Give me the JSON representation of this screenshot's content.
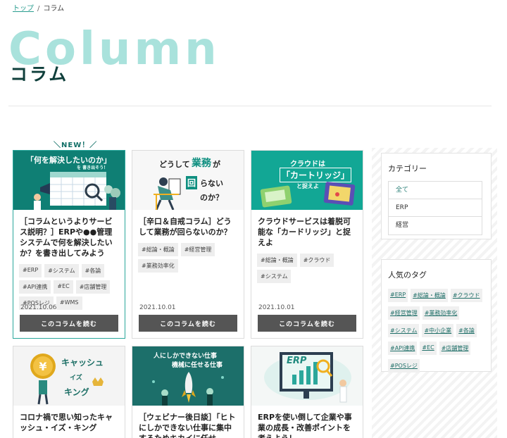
{
  "breadcrumb": {
    "home": "トップ",
    "separator": "/",
    "current": "コラム"
  },
  "hero": {
    "title_en": "Column",
    "title_ja": "コラム"
  },
  "new_label": "＼NEW！／",
  "read_button": "このコラムを読む",
  "cards": [
    {
      "thumb_lines": [
        "「何を解決したいのか」",
        "を 書き出そう！"
      ],
      "title": "［コラムというよりサービス説明？］ERPや●●管理システムで何を解決したいか？を書き出してみよう",
      "tags": [
        "#ERP",
        "#システム",
        "#各論",
        "#API連携",
        "#EC",
        "#店舗管理",
        "#POSレジ",
        "#WMS"
      ],
      "date": "2021.10.06"
    },
    {
      "thumb_lines": [
        "どうして",
        "業務",
        "が",
        "回",
        "らない",
        "のか？"
      ],
      "title": "［辛口＆自戒コラム］どうして業務が回らないのか？",
      "tags": [
        "#総論・概論",
        "#経営管理",
        "#業務効率化"
      ],
      "date": "2021.10.01"
    },
    {
      "thumb_lines": [
        "クラウドは",
        "「カートリッジ」",
        "と捉えよ"
      ],
      "title": "クラウドサービスは着脱可能な「カードリッジ」と捉えよ",
      "tags": [
        "#総論・概論",
        "#クラウド",
        "#システム"
      ],
      "date": "2021.10.01"
    },
    {
      "thumb_lines": [
        "キャッシュ",
        "イズ",
        "キング"
      ],
      "title": "コロナ禍で思い知ったキャッシュ・イズ・キング",
      "tags": [],
      "date": ""
    },
    {
      "thumb_lines": [
        "人にしかできない仕事",
        "機械に任せる仕事"
      ],
      "title": "［ウェビナー後日談］「ヒトにしかできない仕事に集中するためキカイに任せ",
      "tags": [],
      "date": ""
    },
    {
      "thumb_lines": [
        "ERP"
      ],
      "title": "ERPを使い倒して企業や事業の成長・改善ポイントを考えよう！",
      "tags": [],
      "date": ""
    }
  ],
  "sidebar": {
    "category_title": "カテゴリー",
    "categories": [
      "全て",
      "ERP",
      "経営"
    ],
    "popular_title": "人気のタグ",
    "popular_tags": [
      "#ERP",
      "#総論・概論",
      "#クラウド",
      "#経営管理",
      "#業務効率化",
      "#システム",
      "#中小企業",
      "#各論",
      "#API連携",
      "#EC",
      "#店舗管理",
      "#POSレジ"
    ]
  },
  "colors": {
    "accent": "#2aa79b",
    "hero_en": "#a9e2dc",
    "button": "#555555"
  }
}
